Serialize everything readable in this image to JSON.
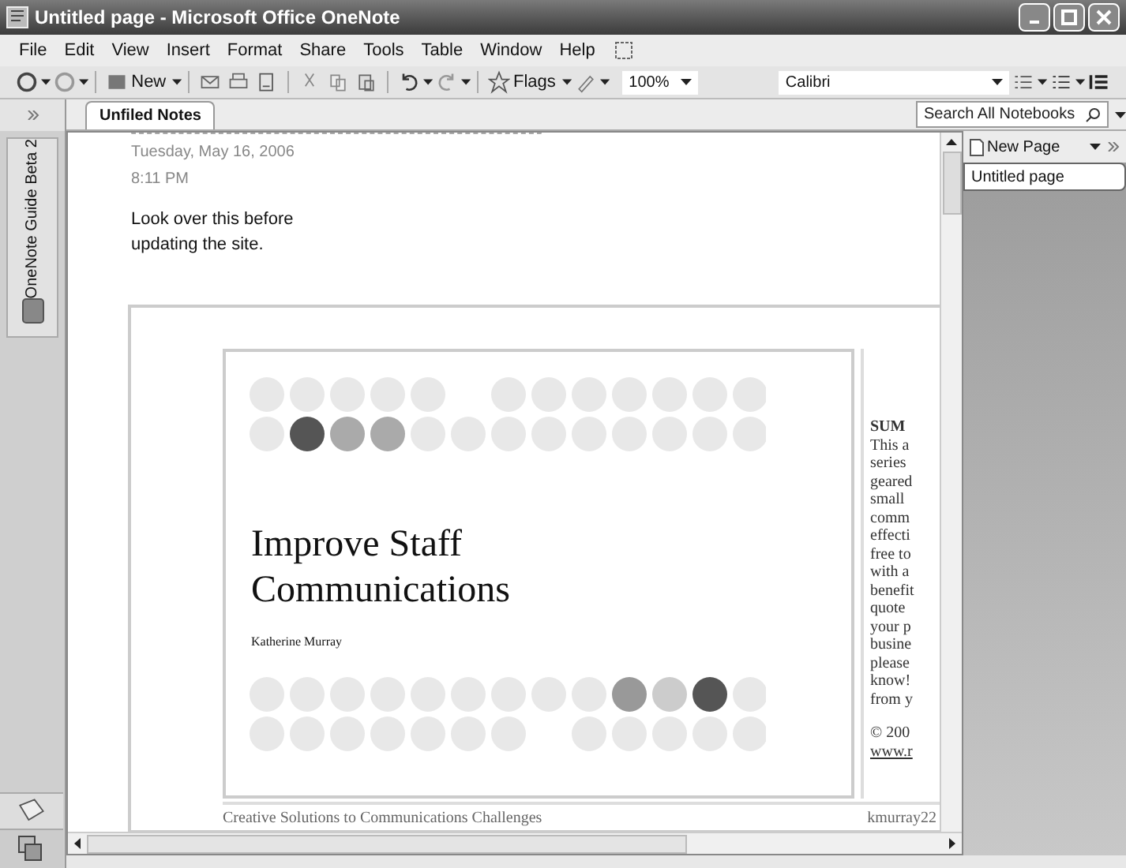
{
  "window": {
    "title": "Untitled page - Microsoft Office OneNote"
  },
  "menu": [
    "File",
    "Edit",
    "View",
    "Insert",
    "Format",
    "Share",
    "Tools",
    "Table",
    "Window",
    "Help"
  ],
  "toolbar": {
    "new_label": "New",
    "flags_label": "Flags",
    "zoom": "100%",
    "font": "Calibri"
  },
  "guide_tab": {
    "label": "OneNote Guide Beta 2"
  },
  "section_tabs": [
    {
      "label": "Unfiled Notes",
      "selected": true
    }
  ],
  "search": {
    "placeholder": "Search All Notebooks"
  },
  "note": {
    "date": "Tuesday, May 16, 2006",
    "time": "8:11 PM",
    "text": "Look over this before updating the site."
  },
  "slide": {
    "title": "Improve Staff Communications",
    "author": "Katherine Murray"
  },
  "side_text": [
    "SUM",
    "This a",
    "series",
    "geared",
    "small",
    "comm",
    "effecti",
    "free to",
    "with a",
    "benefit",
    "quote",
    "your p",
    "busine",
    "please",
    "know!",
    "from y"
  ],
  "side_footer": {
    "copyright": "© 200",
    "link": "www.r"
  },
  "footer": {
    "left": "Creative Solutions to Communications Challenges",
    "right": "kmurray22"
  },
  "page_pane": {
    "new_page": "New Page",
    "pages": [
      {
        "label": "Untitled page",
        "selected": true
      }
    ]
  }
}
